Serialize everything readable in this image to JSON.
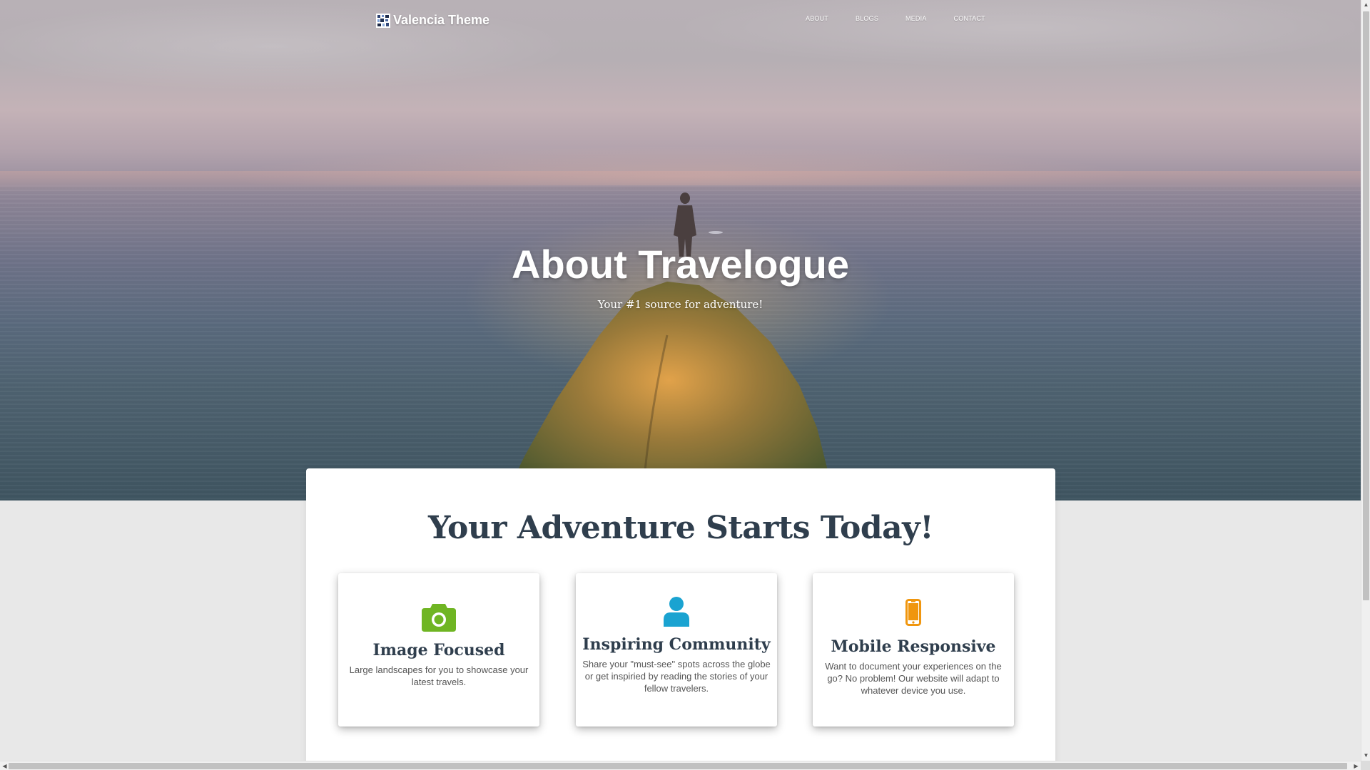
{
  "brand": {
    "name": "Valencia Theme",
    "logo_icon": "pixel-logo-icon"
  },
  "nav": {
    "items": [
      {
        "label": "ABOUT"
      },
      {
        "label": "BLOGS"
      },
      {
        "label": "MEDIA"
      },
      {
        "label": "CONTACT"
      }
    ]
  },
  "hero": {
    "title": "About Travelogue",
    "subtitle": "Your #1 source for adventure!"
  },
  "main": {
    "heading": "Your Adventure Starts Today!",
    "features": [
      {
        "icon": "camera-icon",
        "icon_color": "#6fb523",
        "title": "Image Focused",
        "text": "Large landscapes for you to showcase your latest travels."
      },
      {
        "icon": "user-icon",
        "icon_color": "#1aa3d1",
        "title": "Inspiring Community",
        "text": "Share your \"must-see\" spots across the globe or get inspiried by reading the stories of your fellow travelers."
      },
      {
        "icon": "mobile-phone-icon",
        "icon_color": "#f0960e",
        "title": "Mobile Responsive",
        "text": "Want to document your experiences on the go? No problem! Our website will adapt to whatever device you use."
      }
    ]
  },
  "colors": {
    "heading": "#2f3e4d",
    "body_text": "#555555",
    "page_background": "#e8e8e8"
  }
}
